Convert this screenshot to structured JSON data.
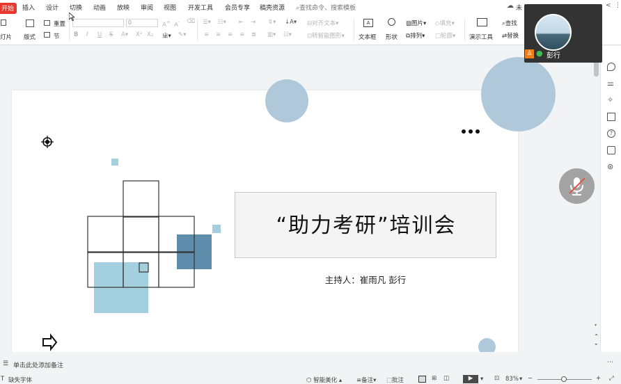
{
  "menu": {
    "active": "开始",
    "tabs": [
      "插入",
      "设计",
      "切换",
      "动画",
      "放映",
      "审阅",
      "视图",
      "开发工具",
      "会员专享",
      "稿壳资源"
    ],
    "search": "查找命令、搜索模板"
  },
  "ribbon": {
    "new_slide": "灯片",
    "layout": "版式",
    "reset": "重置",
    "section": "节",
    "font_size": "0",
    "align_text": "对齐文本",
    "smartart": "转智能图形",
    "textbox": "文本框",
    "shapes": "形状",
    "picture": "图片",
    "fill": "填充",
    "arrange": "排列",
    "outline": "轮廓",
    "presenter": "演示工具",
    "find": "查找",
    "replace": "替换"
  },
  "meeting": {
    "participant_name": "彭行",
    "top_right_partial": "未"
  },
  "slide": {
    "title": "“助力考研”培训会",
    "presenter": "主持人：崔雨凡 彭行"
  },
  "notes": {
    "placeholder": "单击此处添加备注"
  },
  "status": {
    "missing_font": "缺失字体",
    "beautify": "智能美化",
    "notes": "备注",
    "comments": "批注",
    "zoom": "83%"
  },
  "colors": {
    "accent_red": "#e8372c",
    "light_blue": "#a3cfdf",
    "steel_blue": "#5e8cab",
    "pale_blue": "#b0c9da"
  }
}
